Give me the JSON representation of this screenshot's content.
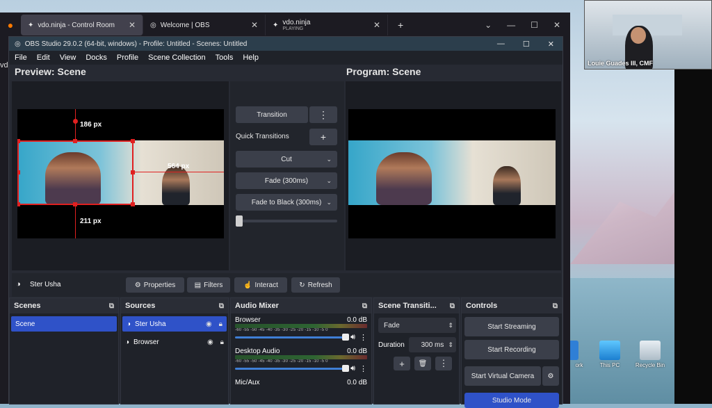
{
  "browser": {
    "tabs": [
      {
        "label": "vdo.ninja - Control Room",
        "icon": "vdo-ninja-icon",
        "active": true
      },
      {
        "label": "Welcome | OBS",
        "icon": "obs-icon"
      },
      {
        "label": "vdo.ninja",
        "sub": "PLAYING",
        "icon": "vdo-ninja-icon"
      }
    ],
    "left_fragment": "vdo"
  },
  "obs": {
    "title": "OBS Studio 29.0.2 (64-bit, windows) - Profile: Untitled - Scenes: Untitled",
    "menu": [
      "File",
      "Edit",
      "View",
      "Docks",
      "Profile",
      "Scene Collection",
      "Tools",
      "Help"
    ],
    "preview_title": "Preview: Scene",
    "program_title": "Program: Scene",
    "distances": {
      "top": "186 px",
      "right": "564 px",
      "bottom": "211 px"
    },
    "transition": {
      "button": "Transition",
      "quick_label": "Quick Transitions",
      "options": [
        "Cut",
        "Fade (300ms)",
        "Fade to Black (300ms)"
      ],
      "slider_value": 0
    },
    "source_bar": {
      "selected_source": "Ster Usha",
      "buttons": [
        "Properties",
        "Filters",
        "Interact",
        "Refresh"
      ]
    },
    "scenes": {
      "title": "Scenes",
      "items": [
        "Scene"
      ]
    },
    "sources": {
      "title": "Sources",
      "items": [
        "Ster Usha",
        "Browser"
      ]
    },
    "mixer": {
      "title": "Audio Mixer",
      "ticks": "-60 -55 -50 -45 -40 -35 -30 -25 -20 -15 -10 -5 0",
      "channels": [
        {
          "name": "Browser",
          "db": "0.0 dB"
        },
        {
          "name": "Desktop Audio",
          "db": "0.0 dB"
        },
        {
          "name": "Mic/Aux",
          "db": "0.0 dB"
        }
      ]
    },
    "scene_transitions": {
      "title": "Scene Transiti...",
      "selected": "Fade",
      "duration_label": "Duration",
      "duration_value": "300 ms"
    },
    "controls": {
      "title": "Controls",
      "buttons": [
        "Start Streaming",
        "Start Recording",
        "Start Virtual Camera",
        "Studio Mode"
      ]
    }
  },
  "webcam": {
    "label": "Louie Guades III, CMF"
  },
  "desktop_icons": [
    "ork",
    "This PC",
    "Recycle Bin"
  ]
}
